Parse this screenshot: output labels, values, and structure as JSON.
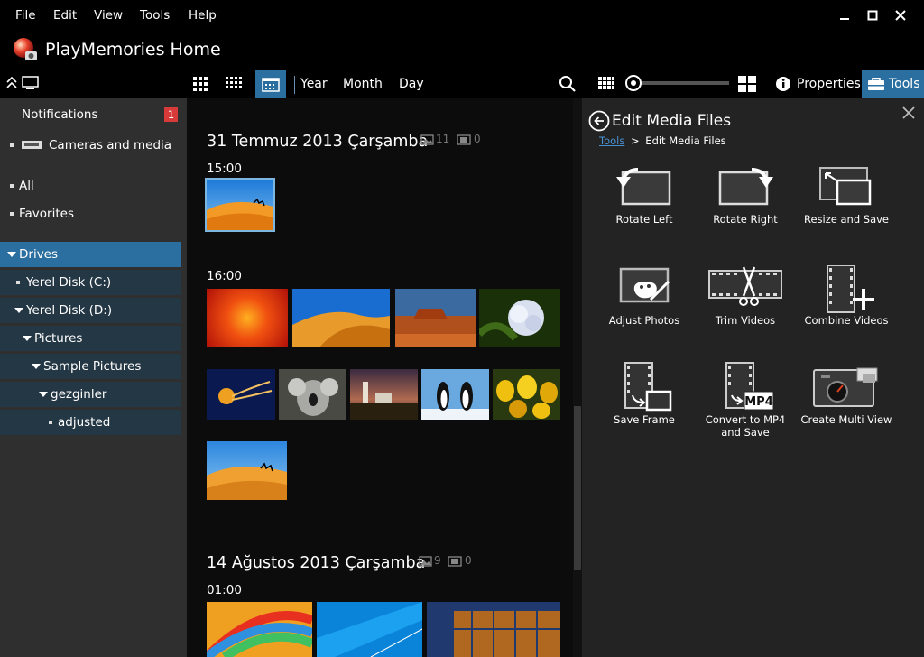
{
  "menu": [
    "File",
    "Edit",
    "View",
    "Tools",
    "Help"
  ],
  "app": {
    "title": "PlayMemories Home"
  },
  "toolbar": {
    "year": "Year",
    "month": "Month",
    "day": "Day",
    "properties": "Properties",
    "tools": "Tools",
    "zoom_level": 0.0
  },
  "sidebar": {
    "notifications": "Notifications",
    "notification_count": "1",
    "cameras": "Cameras and media",
    "all": "All",
    "favorites": "Favorites",
    "drives": "Drives",
    "disk_c": "Yerel Disk (C:)",
    "disk_d": "Yerel Disk (D:)",
    "pictures": "Pictures",
    "sample_pictures": "Sample Pictures",
    "gezginler": "gezginler",
    "adjusted": "adjusted"
  },
  "main": {
    "group1": {
      "date": "31 Temmuz 2013 Çarşamba",
      "photo_count": "11",
      "video_count": "0",
      "time1": "15:00",
      "time2": "16:00"
    },
    "group2": {
      "date": "14 Ağustos 2013 Çarşamba",
      "photo_count": "9",
      "video_count": "0",
      "time1": "01:00"
    }
  },
  "tools_panel": {
    "title": "Edit Media Files",
    "breadcrumb_root": "Tools",
    "breadcrumb_sep": ">",
    "breadcrumb_current": "Edit Media Files",
    "items": [
      "Rotate Left",
      "Rotate Right",
      "Resize and Save",
      "Adjust Photos",
      "Trim Videos",
      "Combine Videos",
      "Save Frame",
      "Convert to MP4 and Save",
      "Create Multi View"
    ],
    "mp4_badge": "MP4"
  },
  "colors": {
    "selected_blue": "#2b6fa0",
    "tree_bg": "#243744",
    "accent_badge": "#d83a3a"
  }
}
